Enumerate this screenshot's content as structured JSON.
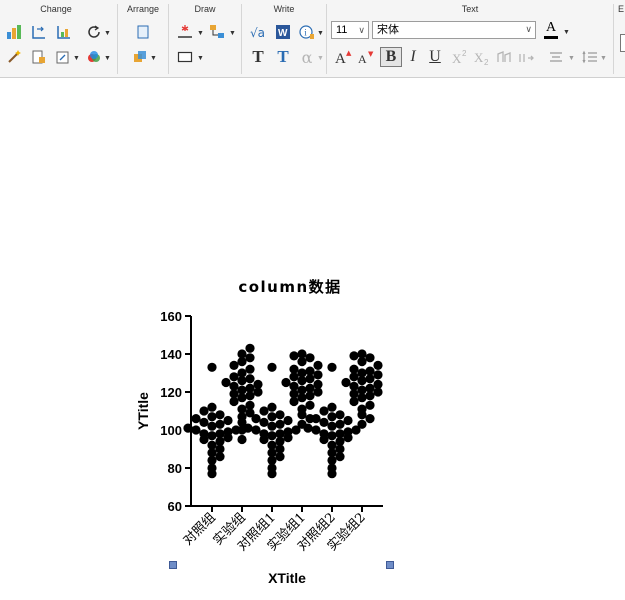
{
  "ribbon": {
    "groups": {
      "change": "Change",
      "arrange": "Arrange",
      "draw": "Draw",
      "write": "Write",
      "text": "Text",
      "partial": "E"
    },
    "font_size": "11",
    "font_name": "宋体",
    "bold_label": "B",
    "italic_label": "I",
    "underline_label": "U",
    "font_color_label": "A",
    "text_tool_label": "T",
    "alpha_label": "α"
  },
  "chart_data": {
    "type": "scatter",
    "title": "column数据",
    "xlabel": "XTitle",
    "ylabel": "YTitle",
    "ylim": [
      60,
      160
    ],
    "yticks": [
      60,
      80,
      100,
      120,
      140,
      160
    ],
    "categories": [
      "对照组",
      "实验组",
      "对照组1",
      "实验组1",
      "对照组2",
      "实验组2"
    ],
    "series": [
      {
        "values": [
          77,
          80,
          84,
          86,
          88,
          90,
          92,
          94,
          95,
          96,
          97,
          98,
          98,
          99,
          100,
          100,
          101,
          102,
          103,
          104,
          105,
          106,
          107,
          108,
          110,
          112,
          133
        ]
      },
      {
        "values": [
          95,
          100,
          104,
          107,
          109,
          111,
          113,
          115,
          117,
          118,
          119,
          120,
          121,
          122,
          123,
          124,
          125,
          126,
          127,
          128,
          130,
          132,
          134,
          136,
          138,
          140,
          143
        ]
      },
      {
        "values": [
          77,
          80,
          84,
          86,
          88,
          90,
          92,
          94,
          95,
          96,
          97,
          98,
          98,
          99,
          100,
          100,
          101,
          102,
          103,
          104,
          105,
          106,
          107,
          108,
          110,
          112,
          133
        ]
      },
      {
        "values": [
          103,
          106,
          108,
          111,
          113,
          115,
          117,
          118,
          119,
          120,
          121,
          122,
          123,
          124,
          125,
          126,
          127,
          128,
          129,
          130,
          131,
          132,
          134,
          136,
          138,
          139,
          140
        ]
      },
      {
        "values": [
          77,
          80,
          84,
          86,
          88,
          90,
          92,
          94,
          95,
          96,
          97,
          98,
          98,
          99,
          100,
          100,
          101,
          102,
          103,
          104,
          105,
          106,
          107,
          108,
          110,
          112,
          133
        ]
      },
      {
        "values": [
          103,
          106,
          108,
          111,
          113,
          115,
          117,
          118,
          119,
          120,
          121,
          122,
          123,
          124,
          125,
          126,
          127,
          128,
          129,
          130,
          131,
          132,
          134,
          136,
          138,
          139,
          140
        ]
      }
    ],
    "point_color": "#000000",
    "grid": false,
    "legend": "none"
  }
}
